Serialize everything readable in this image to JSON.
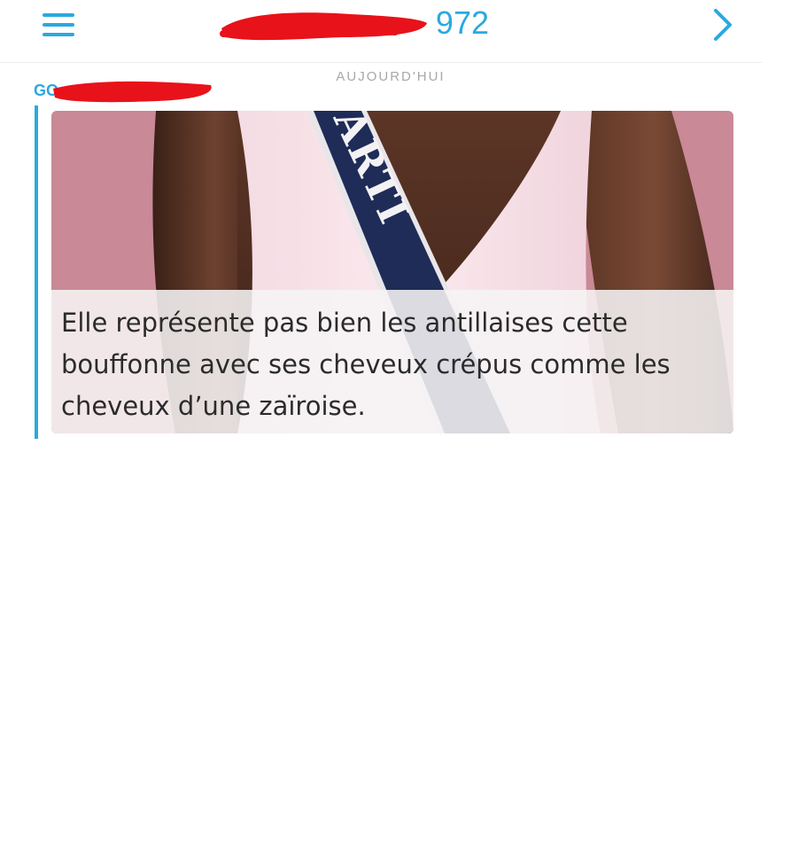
{
  "header": {
    "title": "972",
    "menu_icon": "hamburger-menu-icon",
    "next_icon": "chevron-right-icon",
    "accent_color": "#2aa9e0"
  },
  "conversation": {
    "date_label": "AUJOURD'HUI",
    "sender_name": "GO",
    "message": {
      "caption": "Elle représente pas bien les antillaises cette bouffonne avec ses cheveux crépus comme les cheveux d’une zaïroise.",
      "photo_sash_text": "ARTI"
    }
  },
  "redaction_color": "#e8121a"
}
